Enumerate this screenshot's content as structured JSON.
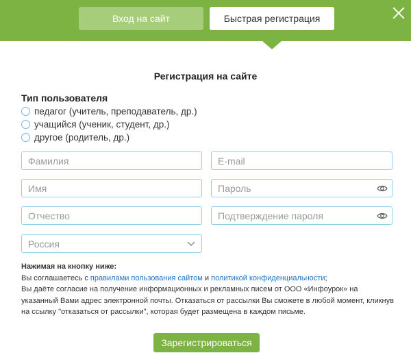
{
  "tabs": {
    "login": "Вход на сайт",
    "register": "Быстрая регистрация"
  },
  "form": {
    "title": "Регистрация на сайте",
    "user_type_title": "Тип пользователя",
    "user_types": [
      "педагог (учитель, преподаватель, др.)",
      "учащийся (ученик, студент, др.)",
      "другое (родитель, др.)"
    ],
    "fields": {
      "last_name": "Фамилия",
      "email": "E-mail",
      "first_name": "Имя",
      "password": "Пароль",
      "middle_name": "Отчество",
      "password_confirm": "Подтверждение пароля",
      "country": "Россия"
    },
    "consent": {
      "heading": "Нажимая на кнопку ниже:",
      "line1_prefix": "Вы соглашаетесь с ",
      "terms_link": "правилами пользования сайтом",
      "and": " и ",
      "privacy_link": "политикой конфиденциальности",
      "line1_suffix": ";",
      "line2": "Вы даёте согласие на получение информационных и рекламных писем от ООО «Инфоурок» на указанный Вами адрес электронной почты. Отказаться от рассылки Вы сможете в любой момент, кликнув на ссылку \"отказаться от рассылки\", которая будет размещена в каждом письме."
    },
    "submit_label": "Зарегистрироваться"
  },
  "colors": {
    "brand_green": "#7cb342",
    "tab_inactive": "#a6cd79",
    "field_border": "#8fd0e8",
    "link": "#1a73c9"
  },
  "icons": {
    "close": "close-icon",
    "eye": "eye-icon",
    "chevron": "chevron-down-icon"
  }
}
